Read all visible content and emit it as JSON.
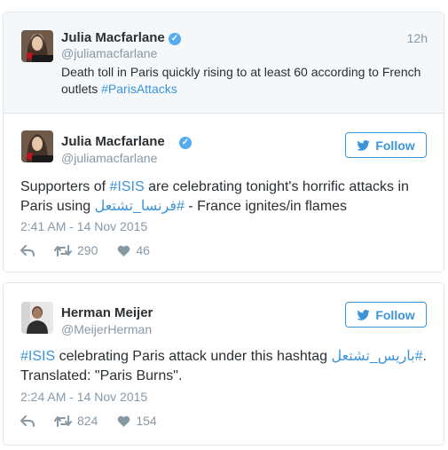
{
  "context_tweet": {
    "name": "Julia Macfarlane",
    "handle": "@juliamacfarlane",
    "time": "12h",
    "text_before": "Death toll in Paris quickly rising to at least 60 according to French outlets ",
    "hashtag": "#ParisAttacks"
  },
  "main_tweet": {
    "name": "Julia Macfarlane",
    "handle": "@juliamacfarlane",
    "follow_label": "Follow",
    "text_part1": "Supporters of ",
    "hashtag1": "#ISIS",
    "text_part2": " are celebrating tonight's horrific attacks in Paris using ",
    "hashtag2": "#فرنسا_تشتعل",
    "text_part3": " - France ignites/in flames",
    "timestamp": "2:41 AM - 14 Nov 2015",
    "retweets": "290",
    "likes": "46"
  },
  "second_tweet": {
    "name": "Herman Meijer",
    "handle": "@MeijerHerman",
    "follow_label": "Follow",
    "hashtag1": "#ISIS",
    "text_part1": " celebrating Paris attack under this hashtag ",
    "hashtag2": "#باريس_تشتعل",
    "text_part2": ".",
    "text_line2": "Translated: \"Paris Burns\".",
    "timestamp": "2:24 AM - 14 Nov 2015",
    "retweets": "824",
    "likes": "154"
  },
  "colors": {
    "link": "#3b94d9",
    "muted": "#8899a6",
    "verified": "#55acee"
  }
}
